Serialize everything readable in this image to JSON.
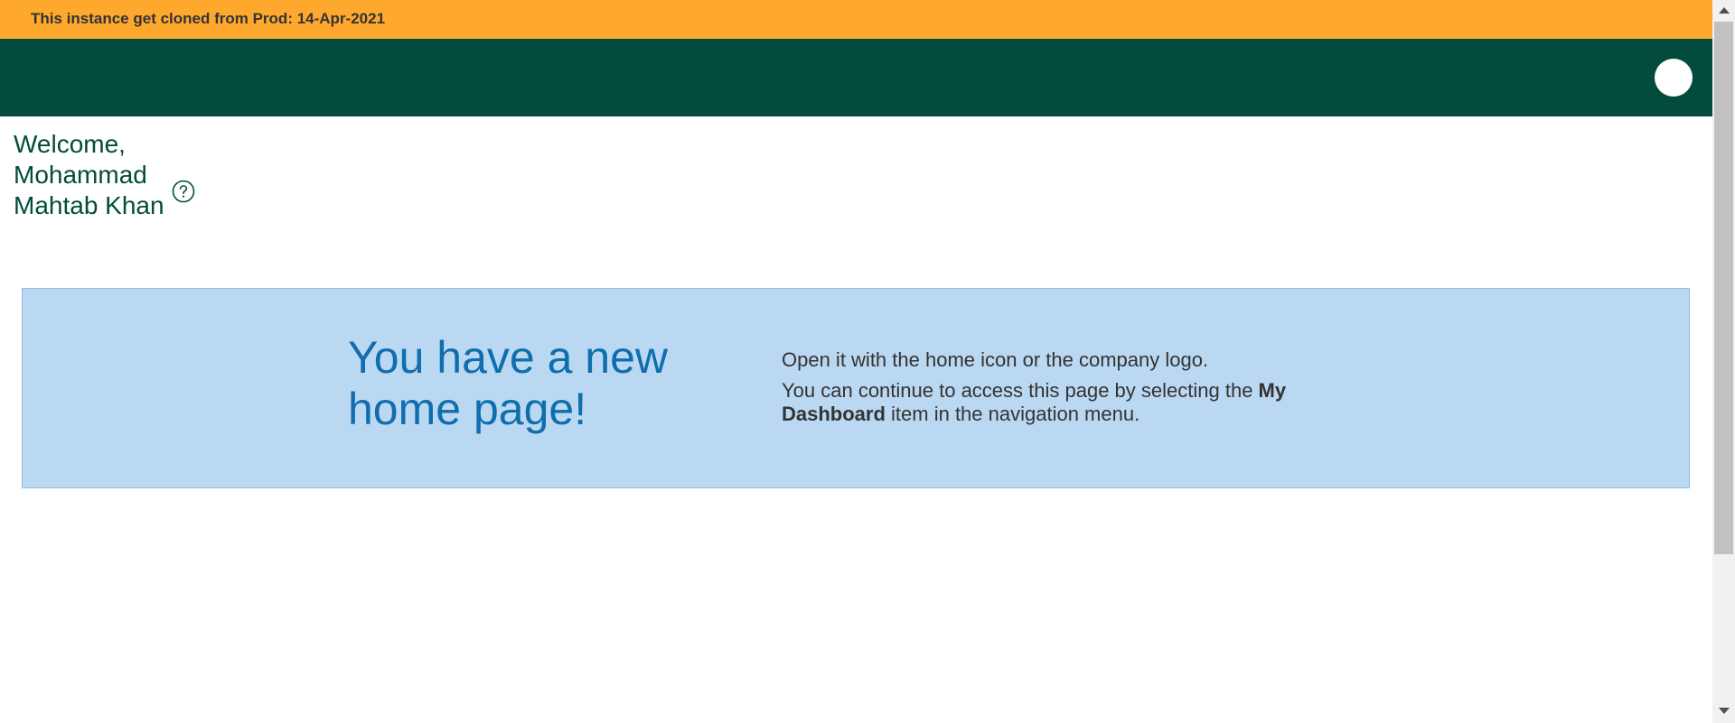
{
  "notice": {
    "text": "This instance get cloned from Prod: 14-Apr-2021"
  },
  "header": {
    "avatar_icon": "user-avatar-icon"
  },
  "welcome": {
    "text": "Welcome, Mohammad Mahtab Khan",
    "help_icon": "help-circle-icon"
  },
  "banner": {
    "heading": "You have a new home page!",
    "line1": "Open it with the home icon or the company logo.",
    "line2_prefix": "You can continue to access this page by selecting the ",
    "line2_bold": "My Dashboard",
    "line2_suffix": " item in the navigation menu."
  },
  "colors": {
    "notice_bg": "#ffa82e",
    "header_bg": "#034c3c",
    "banner_bg": "#bbd8f2",
    "heading_color": "#0f6ead",
    "welcome_color": "#034c3c"
  }
}
